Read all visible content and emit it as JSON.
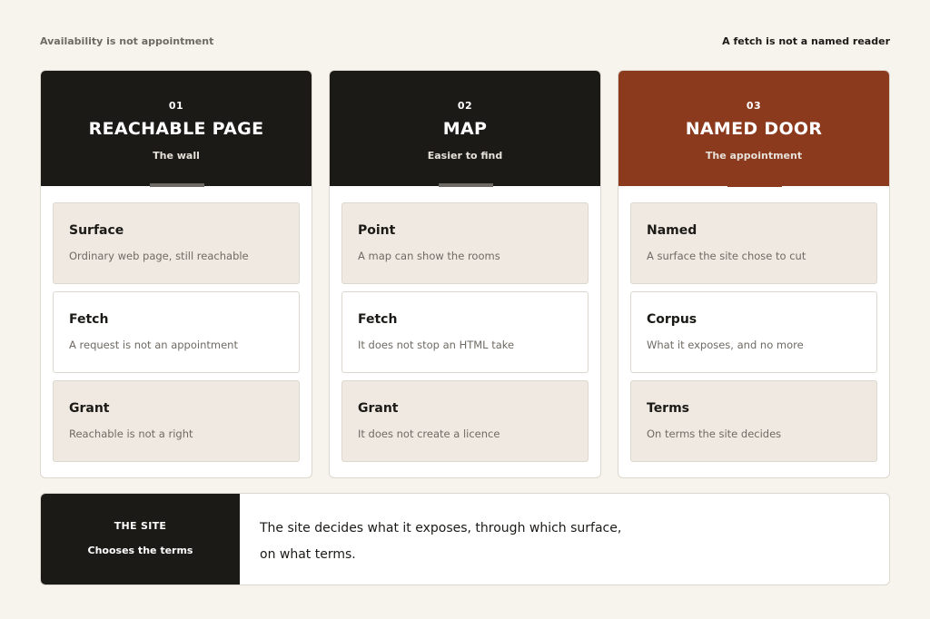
{
  "header": {
    "left": "Availability is not appointment",
    "right": "A fetch is not a named reader"
  },
  "columns": [
    {
      "num": "01",
      "title": "REACHABLE PAGE",
      "sub": "The wall",
      "cards": [
        {
          "title": "Surface",
          "desc": "Ordinary web page, still reachable"
        },
        {
          "title": "Fetch",
          "desc": "A request is not an appointment"
        },
        {
          "title": "Grant",
          "desc": "Reachable is not a right"
        }
      ]
    },
    {
      "num": "02",
      "title": "MAP",
      "sub": "Easier to find",
      "cards": [
        {
          "title": "Point",
          "desc": "A map can show the rooms"
        },
        {
          "title": "Fetch",
          "desc": "It does not stop an HTML take"
        },
        {
          "title": "Grant",
          "desc": "It does not create a licence"
        }
      ]
    },
    {
      "num": "03",
      "title": "NAMED DOOR",
      "sub": "The appointment",
      "cards": [
        {
          "title": "Named",
          "desc": "A surface the site chose to cut"
        },
        {
          "title": "Corpus",
          "desc": "What it exposes, and no more"
        },
        {
          "title": "Terms",
          "desc": "On terms the site decides"
        }
      ]
    }
  ],
  "footer": {
    "label": "THE SITE",
    "sub": "Chooses the terms",
    "line1": "The site decides what it exposes, through which surface,",
    "line2": "on what terms."
  },
  "colors": {
    "dark": "#1c1a17",
    "accent": "#8b3a1e",
    "card_tint": "#efe9e1",
    "background": "#f7f4ee"
  }
}
